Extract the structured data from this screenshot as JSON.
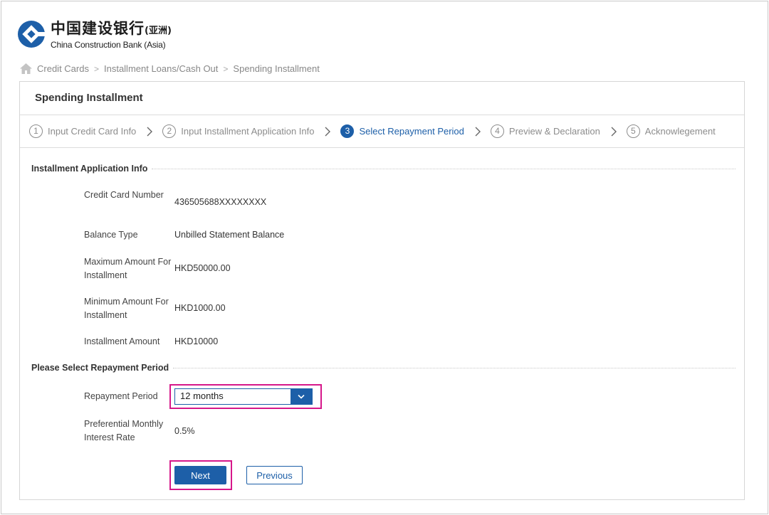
{
  "brand": {
    "name_cn": "中国建设银行",
    "name_cn_suffix": "(亚洲)",
    "name_en": "China Construction Bank (Asia)",
    "color": "#1d5fa8"
  },
  "breadcrumb": {
    "icon": "home-icon",
    "items": [
      "Credit Cards",
      "Installment Loans/Cash Out",
      "Spending Installment"
    ],
    "separator": ">"
  },
  "panel": {
    "title": "Spending Installment"
  },
  "steps": [
    {
      "num": "1",
      "label": "Input Credit Card Info",
      "state": "done"
    },
    {
      "num": "2",
      "label": "Input Installment Application Info",
      "state": "done"
    },
    {
      "num": "3",
      "label": "Select Repayment Period",
      "state": "active"
    },
    {
      "num": "4",
      "label": "Preview & Declaration",
      "state": "pending"
    },
    {
      "num": "5",
      "label": "Acknowlegement",
      "state": "pending"
    }
  ],
  "application_info": {
    "heading": "Installment Application Info",
    "fields": [
      {
        "label": "Credit Card Number",
        "value": "436505688XXXXXXXX"
      },
      {
        "label": "Balance Type",
        "value": "Unbilled Statement Balance"
      },
      {
        "label": "Maximum Amount For Installment",
        "value": "HKD50000.00"
      },
      {
        "label": "Minimum Amount For Installment",
        "value": "HKD1000.00"
      },
      {
        "label": "Installment Amount",
        "value": "HKD10000"
      }
    ]
  },
  "repayment": {
    "heading": "Please Select Repayment Period",
    "period_label": "Repayment Period",
    "period_value": "12 months",
    "rate_label": "Preferential Monthly Interest Rate",
    "rate_value": "0.5%",
    "highlight_color": "#d6178a"
  },
  "actions": {
    "next_label": "Next",
    "previous_label": "Previous"
  }
}
